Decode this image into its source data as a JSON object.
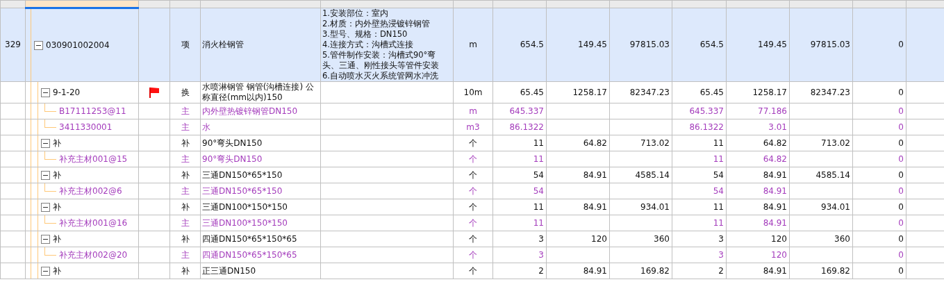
{
  "rows": [
    {
      "number": "329",
      "code": "030901002004",
      "expanded": true,
      "flagged": false,
      "selected": true,
      "kind": "item",
      "type": "项",
      "name": "消火栓钢管",
      "features": [
        "1.安装部位：室内",
        "2.材质：内外壁热浸镀锌钢管",
        "3.型号、规格：DN150",
        "4.连接方式：沟槽式连接",
        "5.管件制作安装：沟槽式90°弯头、三通、刚性接头等管件安装",
        "6.自动喷水灭火系统管网水冲洗"
      ],
      "unit": "m",
      "quantity": "654.5",
      "unit_price": "149.45",
      "total": "97815.03",
      "quantity_2": "654.5",
      "unit_price_2": "149.45",
      "total_2": "97815.03",
      "column_13": "0",
      "children": [
        {
          "code": "9-1-20",
          "expanded": true,
          "flagged": true,
          "selected": false,
          "kind": "item",
          "type": "换",
          "name": "水喷淋钢管 钢管(沟槽连接) 公称直径(mm以内)150",
          "unit": "10m",
          "quantity": "65.45",
          "unit_price": "1258.17",
          "total": "82347.23",
          "quantity_2": "65.45",
          "unit_price_2": "1258.17",
          "total_2": "82347.23",
          "column_13": "0",
          "children": [
            {
              "code": "B17111253@11",
              "flagged": false,
              "selected": false,
              "kind": "material",
              "type": "主",
              "name": "内外壁热镀锌钢管DN150",
              "unit": "m",
              "quantity": "645.337",
              "quantity_2": "645.337",
              "unit_price_2": "77.186",
              "column_13": "0"
            },
            {
              "code": "3411330001",
              "flagged": false,
              "selected": false,
              "kind": "material",
              "type": "主",
              "name": "水",
              "unit": "m3",
              "quantity": "86.1322",
              "quantity_2": "86.1322",
              "unit_price_2": "3.01",
              "column_13": "0"
            }
          ]
        },
        {
          "code": "补",
          "expanded": true,
          "flagged": false,
          "selected": false,
          "kind": "item",
          "type": "补",
          "name": "90°弯头DN150",
          "unit": "个",
          "quantity": "11",
          "unit_price": "64.82",
          "total": "713.02",
          "quantity_2": "11",
          "unit_price_2": "64.82",
          "total_2": "713.02",
          "column_13": "0",
          "children": [
            {
              "code": "补充主材001@15",
              "flagged": false,
              "selected": false,
              "kind": "material",
              "type": "主",
              "name": "90°弯头DN150",
              "unit": "个",
              "quantity": "11",
              "quantity_2": "11",
              "unit_price_2": "64.82",
              "column_13": "0"
            }
          ]
        },
        {
          "code": "补",
          "expanded": true,
          "flagged": false,
          "selected": false,
          "kind": "item",
          "type": "补",
          "name": "三通DN150*65*150",
          "unit": "个",
          "quantity": "54",
          "unit_price": "84.91",
          "total": "4585.14",
          "quantity_2": "54",
          "unit_price_2": "84.91",
          "total_2": "4585.14",
          "column_13": "0",
          "children": [
            {
              "code": "补充主材002@6",
              "flagged": false,
              "selected": false,
              "kind": "material",
              "type": "主",
              "name": "三通DN150*65*150",
              "unit": "个",
              "quantity": "54",
              "quantity_2": "54",
              "unit_price_2": "84.91",
              "column_13": "0"
            }
          ]
        },
        {
          "code": "补",
          "expanded": true,
          "flagged": false,
          "selected": false,
          "kind": "item",
          "type": "补",
          "name": "三通DN100*150*150",
          "unit": "个",
          "quantity": "11",
          "unit_price": "84.91",
          "total": "934.01",
          "quantity_2": "11",
          "unit_price_2": "84.91",
          "total_2": "934.01",
          "column_13": "0",
          "children": [
            {
              "code": "补充主材001@16",
              "flagged": false,
              "selected": false,
              "kind": "material",
              "type": "主",
              "name": "三通DN100*150*150",
              "unit": "个",
              "quantity": "11",
              "quantity_2": "11",
              "unit_price_2": "84.91",
              "column_13": "0"
            }
          ]
        },
        {
          "code": "补",
          "expanded": true,
          "flagged": false,
          "selected": false,
          "kind": "item",
          "type": "补",
          "name": "四通DN150*65*150*65",
          "unit": "个",
          "quantity": "3",
          "unit_price": "120",
          "total": "360",
          "quantity_2": "3",
          "unit_price_2": "120",
          "total_2": "360",
          "column_13": "0",
          "children": [
            {
              "code": "补充主材002@20",
              "flagged": false,
              "selected": false,
              "kind": "material",
              "type": "主",
              "name": "四通DN150*65*150*65",
              "unit": "个",
              "quantity": "3",
              "quantity_2": "3",
              "unit_price_2": "120",
              "column_13": "0"
            }
          ]
        },
        {
          "code": "补",
          "expanded": true,
          "flagged": false,
          "selected": false,
          "kind": "item",
          "type": "补",
          "name": "正三通DN150",
          "unit": "个",
          "quantity": "2",
          "unit_price": "84.91",
          "total": "169.82",
          "quantity_2": "2",
          "unit_price_2": "84.91",
          "total_2": "169.82",
          "column_13": "0"
        }
      ]
    }
  ]
}
